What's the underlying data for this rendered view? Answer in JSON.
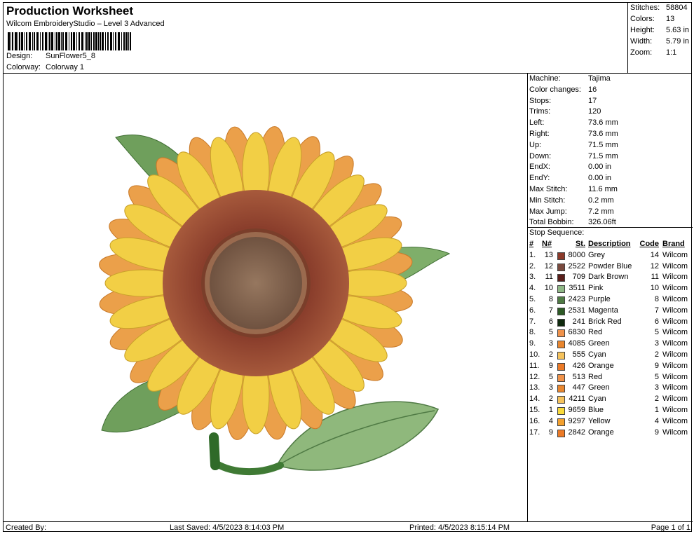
{
  "header": {
    "title": "Production Worksheet",
    "subtitle": "Wilcom EmbroideryStudio – Level 3 Advanced",
    "design_label": "Design:",
    "design_value": "SunFlower5_8",
    "colorway_label": "Colorway:",
    "colorway_value": "Colorway 1"
  },
  "summary": {
    "stitches_label": "Stitches:",
    "stitches_value": "58804",
    "colors_label": "Colors:",
    "colors_value": "13",
    "height_label": "Height:",
    "height_value": "5.63 in",
    "width_label": "Width:",
    "width_value": "5.79 in",
    "zoom_label": "Zoom:",
    "zoom_value": "1:1"
  },
  "properties": [
    {
      "label": "Machine:",
      "value": "Tajima"
    },
    {
      "label": "Color changes:",
      "value": "16"
    },
    {
      "label": "Stops:",
      "value": "17"
    },
    {
      "label": "Trims:",
      "value": "120"
    },
    {
      "label": "Left:",
      "value": "73.6 mm"
    },
    {
      "label": "Right:",
      "value": "73.6 mm"
    },
    {
      "label": "Up:",
      "value": "71.5 mm"
    },
    {
      "label": "Down:",
      "value": "71.5 mm"
    },
    {
      "label": "EndX:",
      "value": "0.00 in"
    },
    {
      "label": "EndY:",
      "value": "0.00 in"
    },
    {
      "label": "Max Stitch:",
      "value": "11.6 mm"
    },
    {
      "label": "Min Stitch:",
      "value": "0.2 mm"
    },
    {
      "label": "Max Jump:",
      "value": "7.2 mm"
    },
    {
      "label": "Total Bobbin:",
      "value": "326.06ft"
    }
  ],
  "stop_sequence": {
    "title": "Stop Sequence:",
    "headers": {
      "num": "#",
      "n": "N#",
      "st": "St.",
      "description": "Description",
      "code": "Code",
      "brand": "Brand"
    },
    "rows": [
      {
        "idx": "1.",
        "n": "13",
        "color": "#8b3a2a",
        "st": "8000",
        "description": "Grey",
        "code": "14",
        "brand": "Wilcom"
      },
      {
        "idx": "2.",
        "n": "12",
        "color": "#7a4a3e",
        "st": "2522",
        "description": "Powder Blue",
        "code": "12",
        "brand": "Wilcom"
      },
      {
        "idx": "3.",
        "n": "11",
        "color": "#5a1e1a",
        "st": "709",
        "description": "Dark Brown",
        "code": "11",
        "brand": "Wilcom"
      },
      {
        "idx": "4.",
        "n": "10",
        "color": "#8fb886",
        "st": "3511",
        "description": "Pink",
        "code": "10",
        "brand": "Wilcom"
      },
      {
        "idx": "5.",
        "n": "8",
        "color": "#4f7a44",
        "st": "2423",
        "description": "Purple",
        "code": "8",
        "brand": "Wilcom"
      },
      {
        "idx": "6.",
        "n": "7",
        "color": "#2e5a26",
        "st": "2531",
        "description": "Magenta",
        "code": "7",
        "brand": "Wilcom"
      },
      {
        "idx": "7.",
        "n": "6",
        "color": "#0f2a0e",
        "st": "241",
        "description": "Brick Red",
        "code": "6",
        "brand": "Wilcom"
      },
      {
        "idx": "8.",
        "n": "5",
        "color": "#f0924a",
        "st": "6830",
        "description": "Red",
        "code": "5",
        "brand": "Wilcom"
      },
      {
        "idx": "9.",
        "n": "3",
        "color": "#e9862e",
        "st": "4085",
        "description": "Green",
        "code": "3",
        "brand": "Wilcom"
      },
      {
        "idx": "10.",
        "n": "2",
        "color": "#f5c25c",
        "st": "555",
        "description": "Cyan",
        "code": "2",
        "brand": "Wilcom"
      },
      {
        "idx": "11.",
        "n": "9",
        "color": "#ec7a26",
        "st": "426",
        "description": "Orange",
        "code": "9",
        "brand": "Wilcom"
      },
      {
        "idx": "12.",
        "n": "5",
        "color": "#f0924a",
        "st": "513",
        "description": "Red",
        "code": "5",
        "brand": "Wilcom"
      },
      {
        "idx": "13.",
        "n": "3",
        "color": "#e9862e",
        "st": "447",
        "description": "Green",
        "code": "3",
        "brand": "Wilcom"
      },
      {
        "idx": "14.",
        "n": "2",
        "color": "#f5c25c",
        "st": "4211",
        "description": "Cyan",
        "code": "2",
        "brand": "Wilcom"
      },
      {
        "idx": "15.",
        "n": "1",
        "color": "#f8d93a",
        "st": "9659",
        "description": "Blue",
        "code": "1",
        "brand": "Wilcom"
      },
      {
        "idx": "16.",
        "n": "4",
        "color": "#f3a02e",
        "st": "9297",
        "description": "Yellow",
        "code": "4",
        "brand": "Wilcom"
      },
      {
        "idx": "17.",
        "n": "9",
        "color": "#ec7a26",
        "st": "2842",
        "description": "Orange",
        "code": "9",
        "brand": "Wilcom"
      }
    ]
  },
  "footer": {
    "created_by": "Created By:",
    "last_saved": "Last Saved: 4/5/2023 8:14:03 PM",
    "printed": "Printed: 4/5/2023 8:15:14 PM",
    "page": "Page 1 of 1"
  },
  "design_colors": {
    "petal_yellow": "#f2cf45",
    "petal_orange": "#eba04a",
    "center_ring": "#9a4e34",
    "center_disc": "#8a6a55",
    "leaf": "#7fae6a",
    "leaf_dark": "#4f8a40"
  }
}
